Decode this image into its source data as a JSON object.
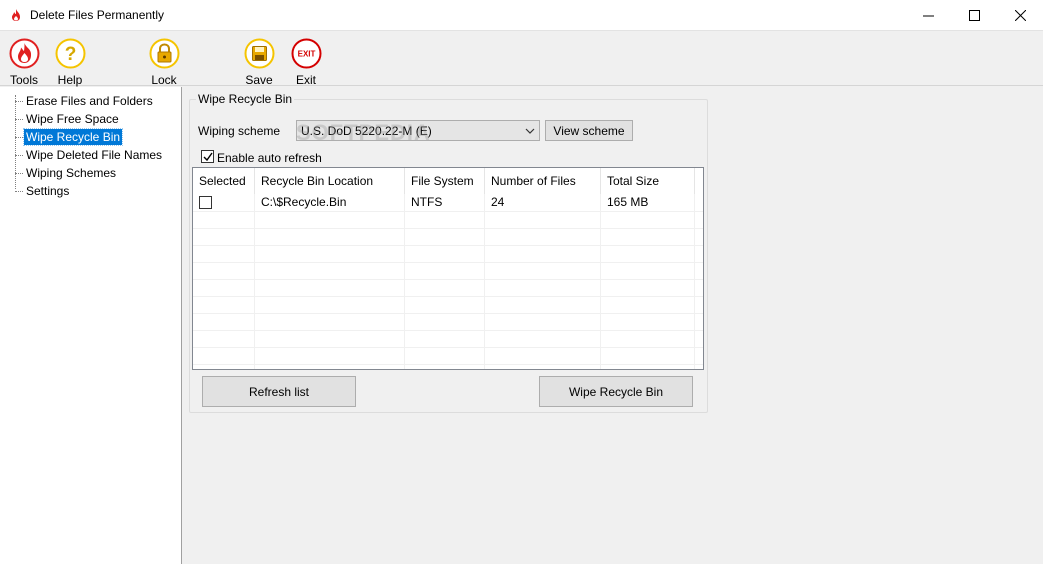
{
  "window": {
    "title": "Delete Files Permanently"
  },
  "toolbar": [
    {
      "label": "Tools",
      "icon": "fire-icon"
    },
    {
      "label": "Help",
      "icon": "question-icon"
    },
    {
      "label": "Lock",
      "icon": "lock-icon"
    },
    {
      "label": "Save",
      "icon": "floppy-disk-icon"
    },
    {
      "label": "Exit",
      "icon": "exit-icon",
      "icon_text": "EXIT"
    }
  ],
  "tree": {
    "items": [
      {
        "label": "Erase Files and Folders"
      },
      {
        "label": "Wipe Free Space"
      },
      {
        "label": "Wipe Recycle Bin",
        "selected": true
      },
      {
        "label": "Wipe Deleted File Names"
      },
      {
        "label": "Wiping Schemes"
      },
      {
        "label": "Settings"
      }
    ]
  },
  "panel": {
    "group_title": "Wipe Recycle Bin",
    "scheme_label": "Wiping scheme",
    "scheme_value": "U.S. DoD 5220.22-M (E)",
    "view_scheme_label": "View scheme",
    "auto_refresh_label": "Enable auto refresh",
    "auto_refresh_checked": true,
    "watermark": "SOFTPEDIA",
    "columns": [
      "Selected",
      "Recycle Bin Location",
      "File System",
      "Number of Files",
      "Total Size"
    ],
    "rows": [
      {
        "selected": false,
        "location": "C:\\$Recycle.Bin",
        "file_system": "NTFS",
        "files": "24",
        "size": "165 MB"
      }
    ],
    "refresh_label": "Refresh list",
    "wipe_label": "Wipe Recycle Bin"
  },
  "colors": {
    "selection": "#0078d7",
    "icon_ring": "#f5c400",
    "fire_red": "#e02020",
    "exit_red": "#d40000"
  }
}
